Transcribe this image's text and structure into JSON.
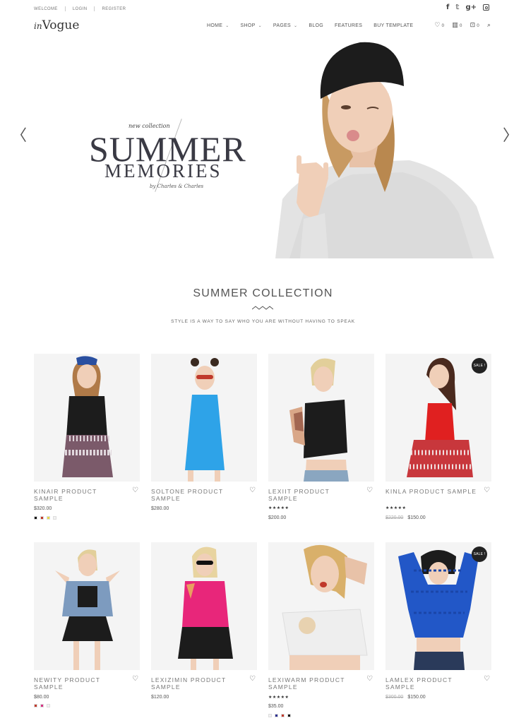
{
  "topbar": {
    "links": [
      "WELCOME",
      "LOGIN",
      "REGISTER"
    ],
    "social": [
      "facebook-icon",
      "twitter-icon",
      "googleplus-icon",
      "instagram-icon"
    ]
  },
  "header": {
    "logo_prefix": "in",
    "logo_main": "Vogue",
    "nav": [
      {
        "label": "HOME",
        "dropdown": true
      },
      {
        "label": "SHOP",
        "dropdown": true
      },
      {
        "label": "PAGES",
        "dropdown": true
      },
      {
        "label": "BLOG",
        "dropdown": false
      },
      {
        "label": "FEATURES",
        "dropdown": false
      },
      {
        "label": "BUY TEMPLATE",
        "dropdown": false
      }
    ],
    "wishlist_count": "0",
    "compare_count": "0",
    "cart_count": "0"
  },
  "hero": {
    "kicker": "new collection",
    "title": "SUMMER",
    "subtitle": "MEMORIES",
    "byline": "by Charles & Charles"
  },
  "section": {
    "title": "SUMMER COLLECTION",
    "subtitle": "STYLE IS A WAY TO SAY WHO YOU ARE WITHOUT HAVING TO SPEAK"
  },
  "products": [
    {
      "name": "KINAIR PRODUCT SAMPLE",
      "price": "$320.00",
      "old_price": "",
      "stars": "",
      "sale": "",
      "swatches": [
        "#111111",
        "#c0392b",
        "#e8d84a",
        "#f2f2f2"
      ]
    },
    {
      "name": "SOLTONE PRODUCT SAMPLE",
      "price": "$280.00",
      "old_price": "",
      "stars": "",
      "sale": "",
      "swatches": []
    },
    {
      "name": "LEXIIT PRODUCT SAMPLE",
      "price": "$200.00",
      "old_price": "",
      "stars": "★★★★★",
      "sale": "",
      "swatches": []
    },
    {
      "name": "KINLA PRODUCT SAMPLE",
      "price": "$150.00",
      "old_price": "$220.00",
      "stars": "★★★★★",
      "sale": "SALE !",
      "swatches": []
    },
    {
      "name": "NEWITY PRODUCT SAMPLE",
      "price": "$80.00",
      "old_price": "",
      "stars": "",
      "sale": "",
      "swatches": [
        "#c0392b",
        "#d63384",
        "#f2f2f2"
      ]
    },
    {
      "name": "LEXIZIMIN PRODUCT SAMPLE",
      "price": "$120.00",
      "old_price": "",
      "stars": "",
      "sale": "",
      "swatches": []
    },
    {
      "name": "LEXIWARM PRODUCT SAMPLE",
      "price": "$35.00",
      "old_price": "",
      "stars": "★★★★★",
      "sale": "",
      "swatches": [
        "#f2f2f2",
        "#2e3192",
        "#c0392b",
        "#111111"
      ]
    },
    {
      "name": "LAMLEX PRODUCT SAMPLE",
      "price": "$150.00",
      "old_price": "$300.00",
      "stars": "",
      "sale": "SALE !",
      "swatches": []
    }
  ]
}
